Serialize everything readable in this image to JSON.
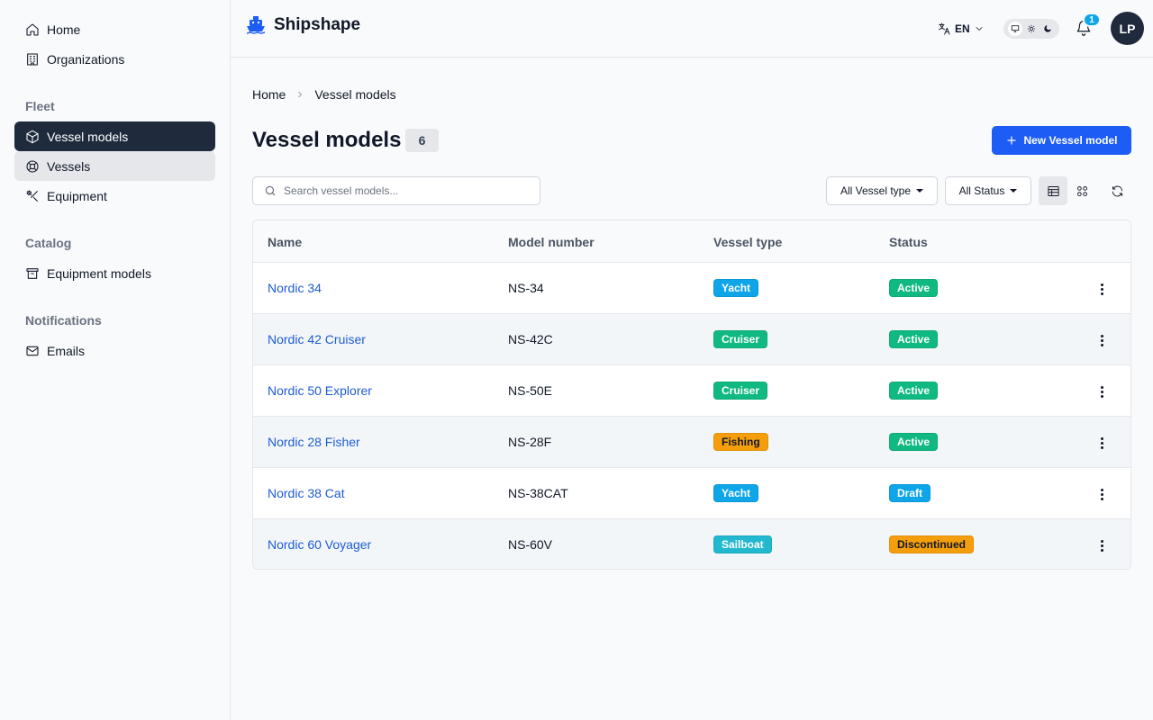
{
  "app": {
    "name": "Shipshape"
  },
  "sidebar": {
    "top_items": [
      {
        "label": "Home",
        "icon": "home-icon"
      },
      {
        "label": "Organizations",
        "icon": "building-icon"
      }
    ],
    "sections": [
      {
        "label": "Fleet",
        "items": [
          {
            "label": "Vessel models",
            "icon": "box-icon"
          },
          {
            "label": "Vessels",
            "icon": "life-ring-icon"
          },
          {
            "label": "Equipment",
            "icon": "tools-icon"
          }
        ]
      },
      {
        "label": "Catalog",
        "items": [
          {
            "label": "Equipment models",
            "icon": "archive-icon"
          }
        ]
      },
      {
        "label": "Notifications",
        "items": [
          {
            "label": "Emails",
            "icon": "mail-icon"
          }
        ]
      }
    ]
  },
  "header": {
    "language": "EN",
    "notifications_count": "1",
    "avatar_initials": "LP",
    "theme_selected": "light"
  },
  "breadcrumb": {
    "items": [
      "Home",
      "Vessel models"
    ]
  },
  "page": {
    "title": "Vessel models",
    "count": "6",
    "new_button_label": "New Vessel model"
  },
  "toolbar": {
    "search_placeholder": "Search vessel models...",
    "filter_type_label": "All Vessel type",
    "filter_status_label": "All Status",
    "view_selected": "table"
  },
  "table": {
    "columns": [
      "Name",
      "Model number",
      "Vessel type",
      "Status"
    ],
    "rows": [
      {
        "name": "Nordic 34",
        "model": "NS-34",
        "type": "Yacht",
        "status": "Active"
      },
      {
        "name": "Nordic 42 Cruiser",
        "model": "NS-42C",
        "type": "Cruiser",
        "status": "Active"
      },
      {
        "name": "Nordic 50 Explorer",
        "model": "NS-50E",
        "type": "Cruiser",
        "status": "Active"
      },
      {
        "name": "Nordic 28 Fisher",
        "model": "NS-28F",
        "type": "Fishing",
        "status": "Active"
      },
      {
        "name": "Nordic 38 Cat",
        "model": "NS-38CAT",
        "type": "Yacht",
        "status": "Draft"
      },
      {
        "name": "Nordic 60 Voyager",
        "model": "NS-60V",
        "type": "Sailboat",
        "status": "Discontinued"
      }
    ]
  },
  "colors": {
    "accent": "#1d5cf5",
    "sidebar_active": "#1f2a3d",
    "tag_yacht": "#0ea5e9",
    "tag_cruiser": "#10b981",
    "tag_fishing": "#f59e0b",
    "tag_sailboat": "#22b8cf",
    "status_active": "#10b981",
    "status_draft": "#0ea5e9",
    "status_discontinued": "#f59e0b"
  }
}
